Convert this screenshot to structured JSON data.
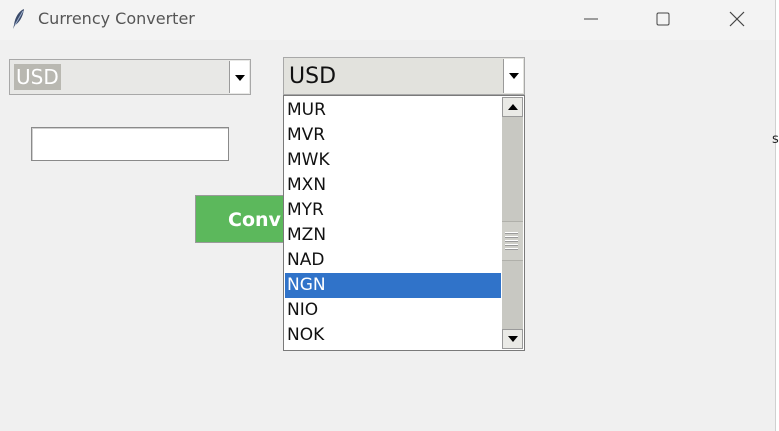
{
  "window": {
    "title": "Currency Converter",
    "icon": "feather-icon"
  },
  "from_currency": {
    "value": "USD"
  },
  "to_currency": {
    "value": "USD",
    "options": [
      "MUR",
      "MVR",
      "MWK",
      "MXN",
      "MYR",
      "MZN",
      "NAD",
      "NGN",
      "NIO",
      "NOK"
    ],
    "selected": "NGN"
  },
  "amount": {
    "value": ""
  },
  "convert_button": {
    "label": "Convert",
    "visible_label": "Conv",
    "color": "#5cb85c"
  },
  "colors": {
    "selection": "#3073c9"
  },
  "edge_fragment": "s"
}
